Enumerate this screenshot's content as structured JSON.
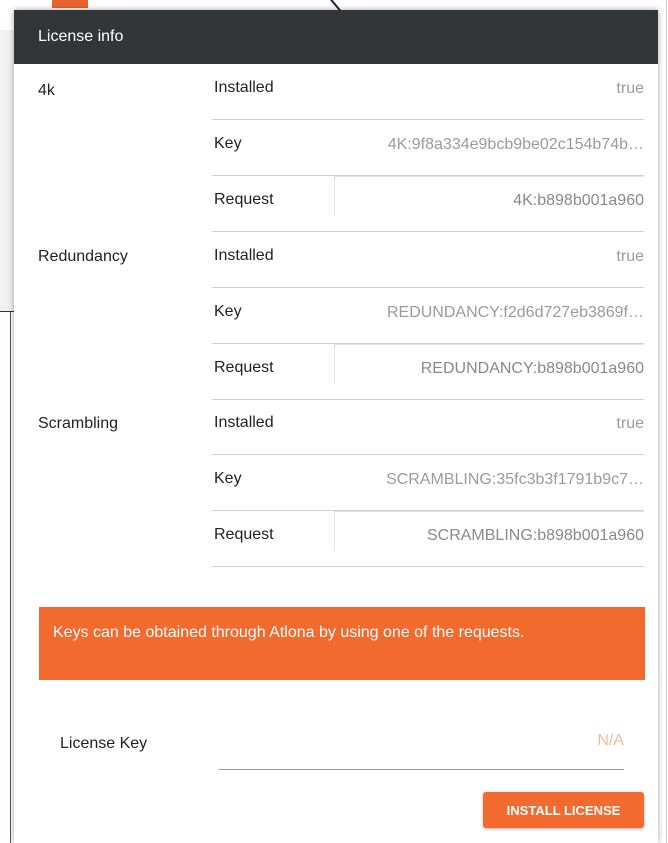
{
  "dialog": {
    "title": "License info"
  },
  "licenses": [
    {
      "name": "4k",
      "installed_label": "Installed",
      "installed_value": "true",
      "key_label": "Key",
      "key_value": "4K:9f8a334e9bcb9be02c154b74b…",
      "request_label": "Request",
      "request_value": "4K:b898b001a960"
    },
    {
      "name": "Redundancy",
      "installed_label": "Installed",
      "installed_value": "true",
      "key_label": "Key",
      "key_value": "REDUNDANCY:f2d6d727eb3869f…",
      "request_label": "Request",
      "request_value": "REDUNDANCY:b898b001a960"
    },
    {
      "name": "Scrambling",
      "installed_label": "Installed",
      "installed_value": "true",
      "key_label": "Key",
      "key_value": "SCRAMBLING:35fc3b3f1791b9c7…",
      "request_label": "Request",
      "request_value": "SCRAMBLING:b898b001a960"
    }
  ],
  "notice": "Keys can be obtained through Atlona by using one of the requests.",
  "license_key": {
    "label": "License Key",
    "value": "",
    "placeholder": "N/A"
  },
  "install_button": "INSTALL LICENSE",
  "colors": {
    "accent": "#f26a2e",
    "header_bg": "#333639"
  }
}
